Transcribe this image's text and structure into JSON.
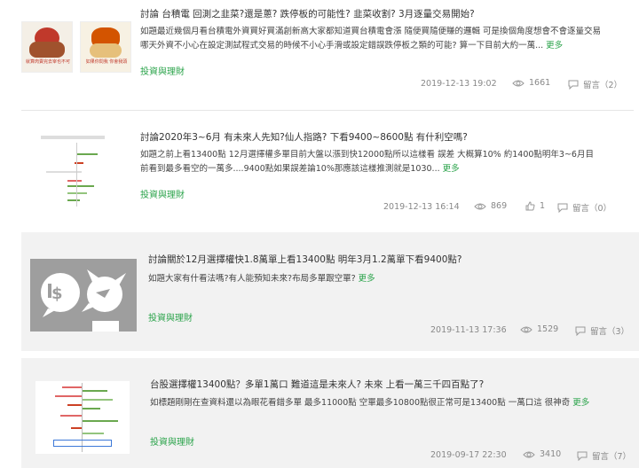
{
  "posts": [
    {
      "title": "討論 台積電 回測之韭菜?還是蔥? 跌停板的可能性? 韭菜收割? 3月逐量交易開始?",
      "excerpt": "如題最近幾個月看台積電外資買好買滿創新高大家都知道買台積電會漲 隨便買隨便賺的邏輯 可是換個角度想會不會逐量交易 哪天外資不小心在設定測試程式交易的時候不小心手滑或設定錯誤跌停板之類的可能? 算一下目前大約一萬...",
      "more": "更多",
      "category": "投資與理財",
      "date": "2019-12-13 19:02",
      "views": "1661",
      "comments": "留言（2）",
      "thumb_text_left": "就算肉賣完去宰也不可",
      "thumb_text_right": "如果你問我 你會我頭"
    },
    {
      "title": "討論2020年3~6月 有未來人先知?仙人指路? 下看9400~8600點 有什利空嗎?",
      "excerpt": "如題之前上看13400點 12月選擇權多單目前大盤以漲到快12000點所以這樣看 誤差 大概算10% 約1400點明年3~6月目前看到最多看空的一萬多....9400點如果誤差論10%那應該這樣推測就是1030...",
      "more": "更多",
      "category": "投資與理財",
      "date": "2019-12-13 16:14",
      "views": "869",
      "likes": "1",
      "comments": "留言（0）"
    },
    {
      "title": "討論關於12月選擇權快1.8萬單上看13400點 明年3月1.2萬單下看9400點?",
      "excerpt": "如題大家有什看法嗎?有人能預知未來?布局多單跟空單?",
      "more": "更多",
      "category": "投資與理財",
      "date": "2019-11-13 17:36",
      "views": "1529",
      "comments": "留言（3）"
    },
    {
      "title": "台股選擇權13400點？多單1萬口 難道這是未來人? 未來 上看一萬三千四百點了?",
      "excerpt": "如標題剛剛在查資料還以為眼花看錯多單 最多11000點 空單最多10800點很正常可是13400點 一萬口這 很神奇",
      "more": "更多",
      "category": "投資與理財",
      "date": "2019-09-17 22:30",
      "views": "3410",
      "comments": "留言（7）"
    }
  ],
  "colors": {
    "accent_green": "#2aa34a",
    "meta_gray": "#888888",
    "avatar_gray": "#9e9e9e"
  },
  "icons": {
    "views": "eye-icon",
    "comments": "comment-icon",
    "likes": "thumbs-up-icon",
    "avatar": "default-avatar-icon"
  }
}
